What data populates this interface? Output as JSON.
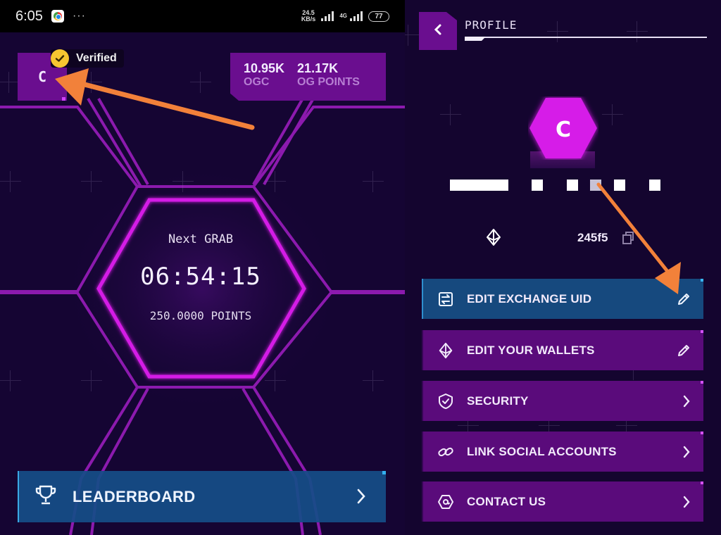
{
  "status_bar": {
    "time": "6:05",
    "app_icon": "chrome-icon",
    "more": "···",
    "net_speed_value": "24.5",
    "net_speed_unit": "KB/s",
    "network_type": "4G",
    "battery": "77"
  },
  "home": {
    "avatar_letter": "C",
    "verified_label": "Verified",
    "stats": [
      {
        "value": "10.95K",
        "label": "OGC"
      },
      {
        "value": "21.17K",
        "label": "OG POINTS"
      }
    ],
    "timer": {
      "title": "Next GRAB",
      "countdown": "06:54:15",
      "reward": "250.0000 POINTS"
    },
    "leaderboard": {
      "label": "LEADERBOARD",
      "icon": "trophy-icon"
    }
  },
  "profile": {
    "title": "PROFILE",
    "back_icon": "chevron-left-icon",
    "avatar_letter": "C",
    "wallet_id_suffix": "245f5",
    "menu": [
      {
        "label": "EDIT EXCHANGE UID",
        "icon": "exchange-icon",
        "trailing": "pencil-icon",
        "style": "blue"
      },
      {
        "label": "EDIT YOUR WALLETS",
        "icon": "ethereum-icon",
        "trailing": "pencil-icon",
        "style": "purple"
      },
      {
        "label": "SECURITY",
        "icon": "shield-check-icon",
        "trailing": "chevron-right-icon",
        "style": "purple"
      },
      {
        "label": "LINK SOCIAL ACCOUNTS",
        "icon": "link-icon",
        "trailing": "chevron-right-icon",
        "style": "purple"
      },
      {
        "label": "CONTACT US",
        "icon": "at-sign-icon",
        "trailing": "chevron-right-icon",
        "style": "purple"
      }
    ]
  },
  "colors": {
    "background": "#150533",
    "accent_purple": "#6a0e8f",
    "neon_magenta": "#d61ee8",
    "menu_blue": "#16497e",
    "menu_purple": "#5a0b7b",
    "annotation_orange": "#f2813a",
    "verified_gold": "#f7c631"
  }
}
